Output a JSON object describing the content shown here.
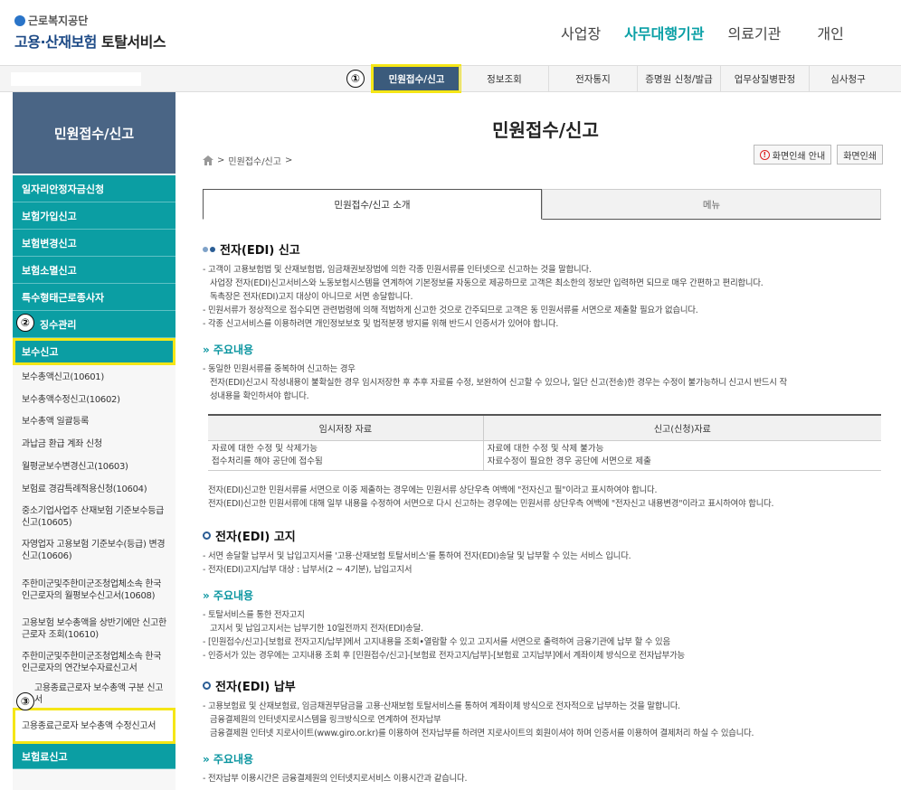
{
  "logo": {
    "org": "근로복지공단",
    "title_part1": "고용·산재보험",
    "title_part2": " 토탈서비스"
  },
  "topnav": [
    "사업장",
    "사무대행기관",
    "의료기관",
    "개인"
  ],
  "submenu": [
    "민원접수/신고",
    "정보조회",
    "전자통지",
    "증명원 신청/발급",
    "업무상질병판정",
    "심사청구"
  ],
  "markers": [
    "①",
    "②",
    "③"
  ],
  "sidebar": {
    "title": "민원접수/신고",
    "teal_items": [
      "일자리안정자금신청",
      "보험가입신고",
      "보험변경신고",
      "보험소멸신고",
      "특수형태근로종사자",
      "징수관리"
    ],
    "active_item": "보수신고",
    "sub_items": [
      "보수총액신고(10601)",
      "보수총액수정신고(10602)",
      "보수총액 일괄등록",
      "과납금 환급 계좌 신청",
      "월평균보수변경신고(10603)",
      "보험료 경감특례적용신청(10604)",
      "중소기업사업주 산재보험 기준보수등급신고(10605)",
      "자영업자 고용보험 기준보수(등급) 변경신고(10606)",
      "주한미군및주한미군조청업체소속 한국인근로자의 월평보수신고서(10608)",
      "고용보험 보수총액을 상반기에만 신고한 근로자 조회(10610)",
      "주한미군및주한미군조청업체소속 한국인근로자의 연간보수자료신고서",
      "고용종료근로자 보수총액 구분 신고서",
      "고용종료근로자 보수총액 수정신고서"
    ],
    "last_teal": "보험료신고"
  },
  "content": {
    "title": "민원접수/신고",
    "breadcrumb": "민원접수/신고",
    "btn_guide": "화면인쇄 안내",
    "btn_print": "화면인쇄",
    "tabs": [
      "민원접수/신고 소개",
      "메뉴"
    ],
    "s1_title": "전자(EDI) 신고",
    "s1_lines": [
      "- 고객이 고용보험법 및 산재보험법, 임금채권보장법에 의한 각종 민원서류를 인터넷으로 신고하는 것을 말합니다.",
      "사업장 전자(EDI)신고서비스와 노동보험시스템을 연계하여 기본정보를 자동으로 제공하므로 고객은 최소한의 정보만 입력하면 되므로 매우 간편하고 편리합니다.",
      "독촉장은 전자(EDI)고지 대상이 아니므로 서면 송달합니다.",
      "- 민원서류가 정상적으로 접수되면 관련법령에 의해 적법하게 신고한 것으로 간주되므로 고객은 동 민원서류를 서면으로 제출할 필요가 없습니다.",
      "- 각종 신고서비스를 이용하려면 개인정보보호 및 법적분쟁 방지를 위해 반드시 인증서가 있어야 합니다."
    ],
    "main_points": "» 주요내용",
    "s1_points": [
      "- 동일한 민원서류를 중복하여 신고하는 경우",
      "전자(EDI)신고시 작성내용이 불확실한 경우 임시저장한 후 추후 자료를 수정, 보완하여 신고할 수 있으나, 일단 신고(전송)한 경우는 수정이 불가능하니 신고시 반드시 작",
      "성내용을 확인하셔야 합니다."
    ],
    "table": {
      "headers": [
        "임시저장 자료",
        "신고(신청)자료"
      ],
      "row1": [
        "자료에 대한 수정 및 삭제가능",
        "자료에 대한 수정 및 삭제 불가능"
      ],
      "row2": [
        "접수처리를 해야 공단에 접수됨",
        "자료수정이 필요한 경우 공단에 서면으로 제출"
      ]
    },
    "s1_after": [
      "전자(EDI)신고한 민원서류를 서면으로 이중 제출하는 경우에는 민원서류 상단우측 여백에 \"전자신고 필\"이라고 표시하여야 합니다.",
      "전자(EDI)신고한 민원서류에 대해 일부 내용을 수정하여 서면으로 다시 신고하는 경우에는 민원서류 상단우측 여백에 \"전자신고 내용변경\"이라고 표시하여야 합니다."
    ],
    "s2_title": "전자(EDI) 고지",
    "s2_lines": [
      "- 서면 송달할 납부서 및 납입고지서를 '고용·산재보험 토탈서비스'를 통하여 전자(EDI)송달 및 납부할 수 있는 서비스 입니다.",
      "- 전자(EDI)고지/납부 대상 : 납부서(2 ~ 4기분), 납입고지서"
    ],
    "s2_points": [
      "- 토탈서비스를 통한 전자고지",
      "고지서 및 납입고지서는 납부기한 10일전까지 전자(EDI)송달.",
      "- [민원접수/신고]-[보험료 전자고지/납부]에서 고지내용을 조회•열람할 수 있고 고지서를 서면으로 출력하여 금융기관에 납부 할 수 있음",
      "- 인증서가 있는 경우에는 고지내용 조회 후 [민원접수/신고]-[보험료 전자고지/납부]-[보험료 고지납부]에서 계좌이체 방식으로 전자납부가능"
    ],
    "s3_title": "전자(EDI) 납부",
    "s3_lines": [
      "- 고용보험료 및 산재보험료, 임금채권부담금을 고용·산재보험 토탈서비스를 통하여 계좌이체 방식으로 전자적으로 납부하는 것을 말합니다.",
      "금융결제원의 인터넷지로시스템을 링크방식으로 연계하여 전자납부",
      "금융결제원 인터넷 지로사이트(www.giro.or.kr)를 이용하여 전자납부를 하려면 지로사이트의 회원이셔야 하며 인증서를 이용하여 결제처리 하실 수 있습니다."
    ],
    "s3_last": "- 전자납부 이용시간은 금융결제원의 인터넷지로서비스 이용시간과 같습니다."
  }
}
